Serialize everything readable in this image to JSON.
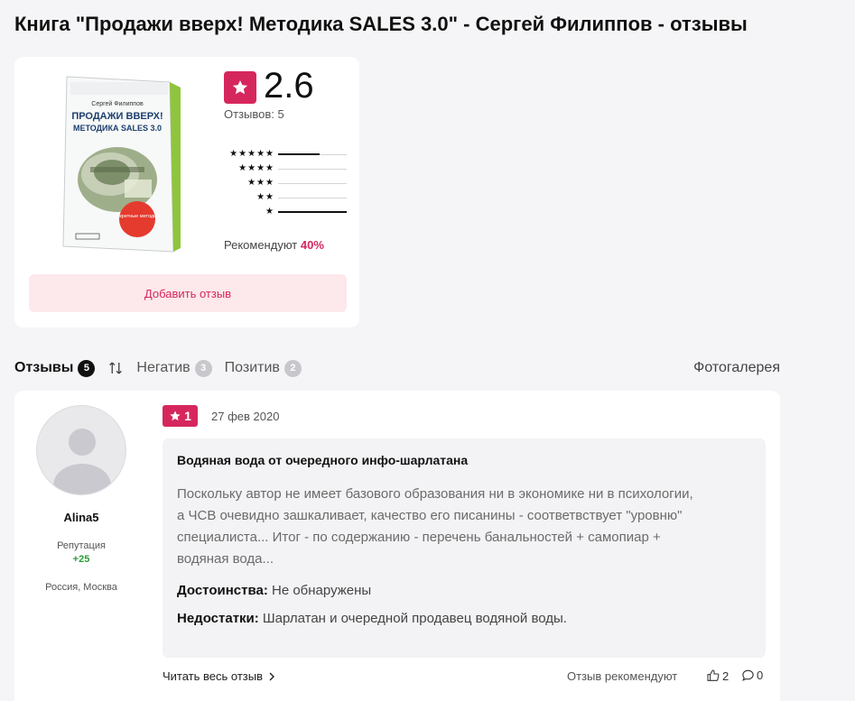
{
  "page": {
    "title": "Книга \"Продажи вверх! Методика SALES 3.0\" - Сергей Филиппов - отзывы"
  },
  "summary": {
    "cover": {
      "author": "Сергей Филиппов",
      "title_line1": "ПРОДАЖИ ВВЕРХ!",
      "title_line2": "МЕТОДИКА SALES 3.0",
      "badge": "Секретные методики"
    },
    "rating": "2.6",
    "reviews_count": "Отзывов: 5",
    "distribution": [
      {
        "stars": "★★★★★",
        "fraction": 0.6
      },
      {
        "stars": "★★★★",
        "fraction": 0.0
      },
      {
        "stars": "★★★",
        "fraction": 0.0
      },
      {
        "stars": "★★",
        "fraction": 0.0
      },
      {
        "stars": "★",
        "fraction": 1.0
      }
    ],
    "recommend_label": "Рекомендуют",
    "recommend_value": "40%",
    "add_review": "Добавить отзыв"
  },
  "tabs": {
    "reviews": {
      "label": "Отзывы",
      "count": "5"
    },
    "negative": {
      "label": "Негатив",
      "count": "3"
    },
    "positive": {
      "label": "Позитив",
      "count": "2"
    },
    "gallery": "Фотогалерея"
  },
  "review": {
    "user": {
      "name": "Alina5",
      "reputation_label": "Репутация",
      "reputation_value": "+25",
      "location": "Россия, Москва"
    },
    "score": "1",
    "date": "27 фев 2020",
    "title": "Водяная вода от очередного инфо-шарлатана",
    "text": "Поскольку автор не имеет базового образования ни в экономике ни в психологии, а ЧСВ очевидно зашкаливает, качество его писанины - соответвствует \"уровню\" специалиста... Итог - по содержанию - перечень банальностей + самопиар + водяная вода...",
    "pros_label": "Достоинства:",
    "pros": " Не обнаружены",
    "cons_label": "Недостатки:",
    "cons": " Шарлатан и очередной продавец водяной воды.",
    "read_more": "Читать весь отзыв",
    "recommended_label": "Отзыв рекомендуют",
    "likes": "2",
    "comments": "0"
  },
  "colors": {
    "accent": "#d6275d",
    "accent_light": "#fde8ec",
    "reputation": "#2a9d3a"
  },
  "icons": [
    "star-icon",
    "sort-icon",
    "chevron-right-icon",
    "thumb-up-icon",
    "comment-icon",
    "user-avatar-icon"
  ]
}
